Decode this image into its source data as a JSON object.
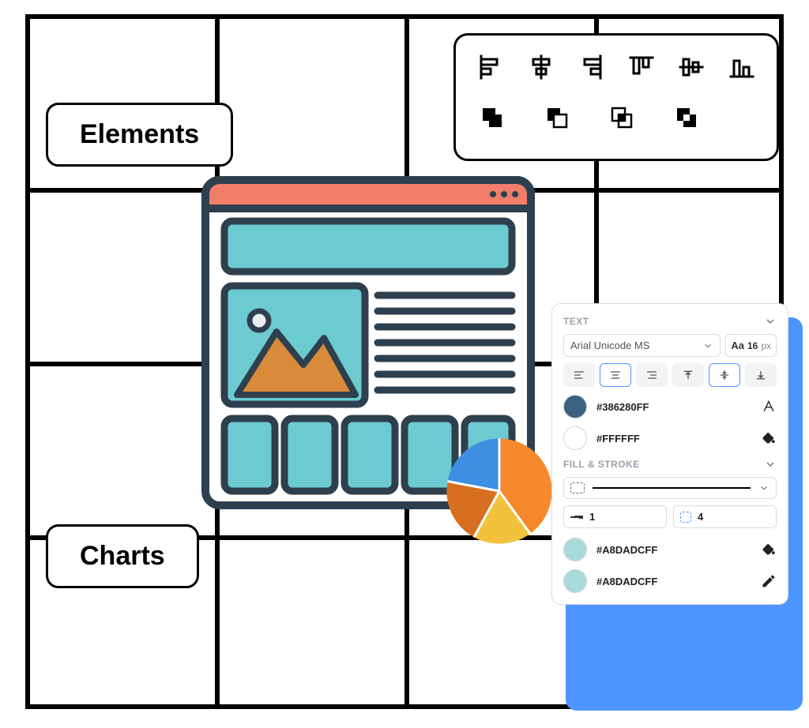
{
  "tags": {
    "elements": "Elements",
    "charts": "Charts"
  },
  "align_toolbar": {
    "row1": [
      "align-left",
      "align-center-h",
      "align-right",
      "align-top",
      "align-middle-v",
      "align-bottom"
    ],
    "row2": [
      "boolean-union",
      "boolean-subtract",
      "boolean-intersect",
      "boolean-exclude"
    ]
  },
  "pie": {
    "slices": [
      {
        "color": "#F6892C",
        "pct": 40
      },
      {
        "color": "#3E8FE2",
        "pct": 22
      },
      {
        "color": "#D86F20",
        "pct": 20
      },
      {
        "color": "#F3C23C",
        "pct": 18
      }
    ]
  },
  "panel": {
    "text": {
      "header": "TEXT",
      "font": "Arial Unicode MS",
      "size_label": "Aa",
      "size_value": "16",
      "size_unit": "px",
      "halign_selected": "center",
      "valign_selected": "middle",
      "colors": [
        {
          "hex": "#386280FF",
          "swatch": "#3A6280",
          "icon": "text-color"
        },
        {
          "hex": "#FFFFFF",
          "swatch": "#FFFFFF",
          "icon": "fill-bucket"
        }
      ]
    },
    "fill_stroke": {
      "header": "FILL & STROKE",
      "stroke_width": "1",
      "corner_radius": "4",
      "colors": [
        {
          "hex": "#A8DADCFF",
          "swatch": "#A8DADC",
          "icon": "fill-bucket"
        },
        {
          "hex": "#A8DADCFF",
          "swatch": "#A8DADC",
          "icon": "edit-pencil"
        }
      ]
    }
  }
}
